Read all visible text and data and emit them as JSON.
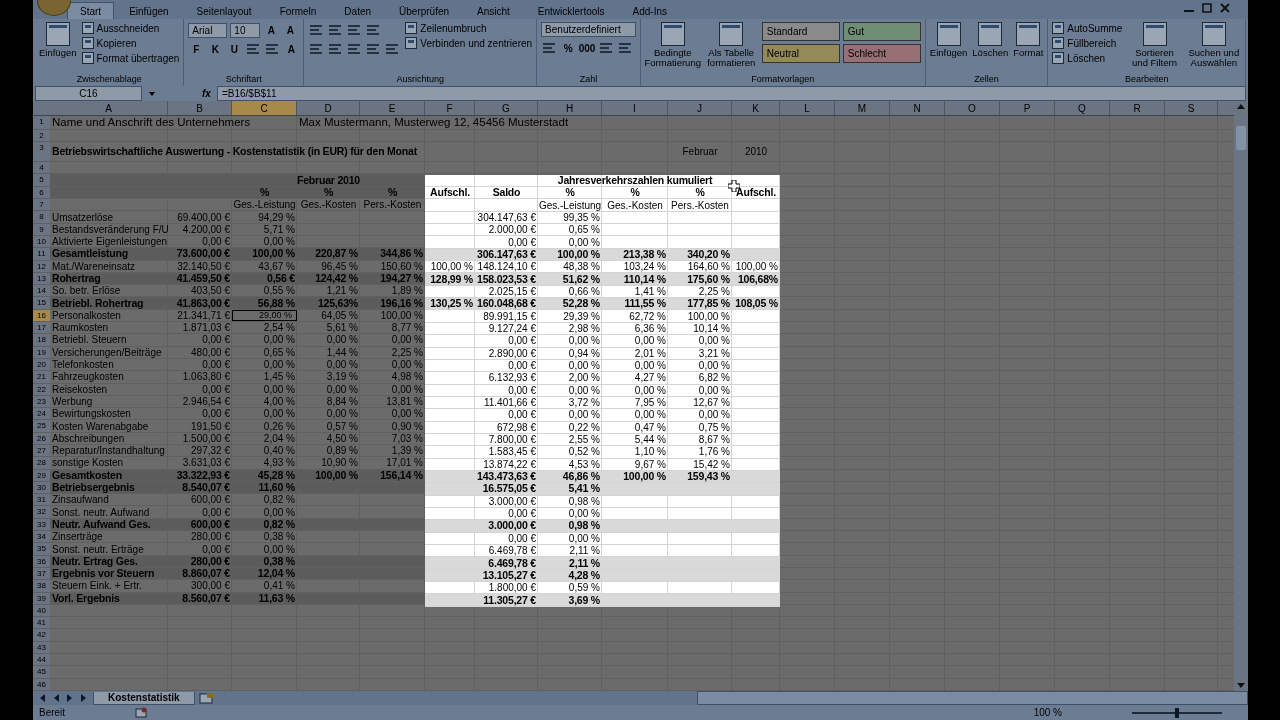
{
  "ribbon": {
    "tabs": [
      {
        "label": "Start",
        "selected": true
      },
      {
        "label": "Einfügen",
        "selected": false
      },
      {
        "label": "Seitenlayout",
        "selected": false
      },
      {
        "label": "Formeln",
        "selected": false
      },
      {
        "label": "Daten",
        "selected": false
      },
      {
        "label": "Überprüfen",
        "selected": false
      },
      {
        "label": "Ansicht",
        "selected": false
      },
      {
        "label": "Entwicklertools",
        "selected": false
      },
      {
        "label": "Add-Ins",
        "selected": false
      }
    ],
    "groups": [
      {
        "label": "Zwischenablage",
        "stacks": [
          [
            [
              {
                "kind": "large",
                "label": "Einfügen"
              }
            ]
          ],
          [
            [
              {
                "kind": "small",
                "label": "Ausschneiden"
              }
            ],
            [
              {
                "kind": "small",
                "label": "Kopieren"
              }
            ],
            [
              {
                "kind": "small",
                "label": "Format übertragen"
              }
            ]
          ]
        ]
      },
      {
        "label": "Schriftart",
        "stacks": [
          [
            [
              {
                "kind": "dropdown",
                "value": "Arial"
              },
              {
                "kind": "dropdown",
                "value": "10"
              },
              {
                "kind": "glyph",
                "label": "A"
              },
              {
                "kind": "glyph",
                "label": "A"
              }
            ],
            [
              {
                "kind": "glyph",
                "label": "F"
              },
              {
                "kind": "glyph",
                "label": "K"
              },
              {
                "kind": "glyph",
                "label": "U"
              },
              {
                "kind": "icon"
              },
              {
                "kind": "icon"
              },
              {
                "kind": "glyph",
                "label": "A"
              }
            ]
          ]
        ]
      },
      {
        "label": "Ausrichtung",
        "stacks": [
          [
            [
              {
                "kind": "icon"
              },
              {
                "kind": "icon"
              },
              {
                "kind": "icon"
              },
              {
                "kind": "icon"
              }
            ],
            [
              {
                "kind": "icon"
              },
              {
                "kind": "icon"
              },
              {
                "kind": "icon"
              },
              {
                "kind": "icon"
              },
              {
                "kind": "icon"
              }
            ]
          ],
          [
            [
              {
                "kind": "small",
                "label": "Zeilenumbruch"
              }
            ],
            [
              {
                "kind": "small",
                "label": "Verbinden und zentrieren"
              }
            ]
          ]
        ]
      },
      {
        "label": "Zahl",
        "stacks": [
          [
            [
              {
                "kind": "dropdown",
                "value": "Benutzerdefiniert"
              }
            ],
            [
              {
                "kind": "icon"
              },
              {
                "kind": "glyph",
                "label": "%"
              },
              {
                "kind": "glyph",
                "label": "000"
              },
              {
                "kind": "icon"
              },
              {
                "kind": "icon"
              }
            ]
          ]
        ]
      },
      {
        "label": "Formatvorlagen",
        "stacks": [
          [
            [
              {
                "kind": "large",
                "label": "Bedingte Formatierung"
              }
            ]
          ],
          [
            [
              {
                "kind": "large",
                "label": "Als Tabelle formatieren"
              }
            ]
          ],
          [
            [
              {
                "kind": "style",
                "label": "Standard",
                "color": "#8a8a8a"
              },
              {
                "kind": "style",
                "label": "Gut",
                "color": "#6f8f74"
              }
            ],
            [
              {
                "kind": "style",
                "label": "Neutral",
                "color": "#948a58"
              },
              {
                "kind": "style",
                "label": "Schlecht",
                "color": "#977076"
              }
            ]
          ]
        ]
      },
      {
        "label": "Zellen",
        "stacks": [
          [
            [
              {
                "kind": "large",
                "label": "Einfügen"
              }
            ]
          ],
          [
            [
              {
                "kind": "large",
                "label": "Löschen"
              }
            ]
          ],
          [
            [
              {
                "kind": "large",
                "label": "Format"
              }
            ]
          ]
        ]
      },
      {
        "label": "Bearbeiten",
        "stacks": [
          [
            [
              {
                "kind": "small",
                "label": "AutoSumme"
              }
            ],
            [
              {
                "kind": "small",
                "label": "Füllbereich"
              }
            ],
            [
              {
                "kind": "small",
                "label": "Löschen"
              }
            ]
          ],
          [
            [
              {
                "kind": "large",
                "label": "Sortieren und Filtern"
              }
            ]
          ],
          [
            [
              {
                "kind": "large",
                "label": "Suchen und Auswählen"
              }
            ]
          ]
        ]
      }
    ]
  },
  "formula_bar": {
    "name_box": "C16",
    "function_label": "fx",
    "formula": "=B16/$B$11"
  },
  "sheet": {
    "columns": [
      {
        "label": "A",
        "selected": false
      },
      {
        "label": "B",
        "selected": false
      },
      {
        "label": "C",
        "selected": true
      },
      {
        "label": "D",
        "selected": false
      },
      {
        "label": "E",
        "selected": false
      },
      {
        "label": "F",
        "selected": false
      },
      {
        "label": "G",
        "selected": false
      },
      {
        "label": "H",
        "selected": false
      },
      {
        "label": "I",
        "selected": false
      },
      {
        "label": "J",
        "selected": false
      },
      {
        "label": "K",
        "selected": false
      },
      {
        "label": "L",
        "selected": false
      },
      {
        "label": "M",
        "selected": false
      },
      {
        "label": "N",
        "selected": false
      },
      {
        "label": "O",
        "selected": false
      },
      {
        "label": "P",
        "selected": false
      },
      {
        "label": "Q",
        "selected": false
      },
      {
        "label": "R",
        "selected": false
      },
      {
        "label": "S",
        "selected": false
      }
    ],
    "rows": [
      {
        "number": "1",
        "selected": false,
        "kind": "note",
        "bold": false,
        "shaded": false,
        "cells": {
          "A": "Name und Anschrift des Unternehmers",
          "D": "Max Mustermann, Musterweg 12, 45456 Musterstadt"
        }
      },
      {
        "number": "2",
        "selected": false,
        "kind": "plain",
        "shaded": false,
        "cells": {}
      },
      {
        "number": "3",
        "selected": false,
        "kind": "title",
        "bold": true,
        "shaded": false,
        "cells": {
          "A": "Betriebswirtschaftliche Auswertung - Kostenstatistik (in EUR) für den Monat",
          "J": "Februar",
          "K": "2010"
        }
      },
      {
        "number": "4",
        "selected": false,
        "kind": "plain",
        "shaded": false,
        "cells": {}
      },
      {
        "number": "5",
        "selected": false,
        "kind": "header",
        "bold": true,
        "shaded": true,
        "cells": {
          "D": "Februar 2010"
        },
        "spotlight": {
          "bold": true,
          "shaded": false,
          "cells": {
            "I": "Jahresverkehrszahlen kumuliert"
          }
        }
      },
      {
        "number": "6",
        "selected": false,
        "kind": "header",
        "bold": true,
        "shaded": true,
        "cells": {
          "C": "%",
          "D": "%",
          "E": "%"
        },
        "spotlight": {
          "bold": true,
          "shaded": false,
          "cells": {
            "F": "Aufschl.",
            "G": "Saldo",
            "H": "%",
            "I": "%",
            "J": "%",
            "K": "Aufschl."
          }
        }
      },
      {
        "number": "7",
        "selected": false,
        "kind": "header",
        "bold": false,
        "shaded": false,
        "cells": {
          "C": "Ges.-Leistung",
          "D": "Ges.-Kosten",
          "E": "Pers.-Kosten"
        },
        "spotlight": {
          "bold": false,
          "shaded": false,
          "cells": {
            "H": "Ges.-Leistung",
            "I": "Ges.-Kosten",
            "J": "Pers.-Kosten"
          }
        }
      },
      {
        "number": "8",
        "selected": false,
        "kind": "plain",
        "bold": false,
        "shaded": false,
        "cells": {
          "A": "Umsatzerlöse",
          "B": "69.400,00 €",
          "C": "94,29 %"
        },
        "spotlight": {
          "bold": false,
          "shaded": false,
          "cells": {
            "G": "304.147,63 €",
            "H": "99,35 %"
          }
        }
      },
      {
        "number": "9",
        "selected": false,
        "kind": "plain",
        "bold": false,
        "shaded": false,
        "cells": {
          "A": "Bestandsveränderung F/U",
          "B": "4.200,00 €",
          "C": "5,71 %"
        },
        "spotlight": {
          "bold": false,
          "shaded": false,
          "cells": {
            "G": "2.000,00 €",
            "H": "0,65 %"
          }
        }
      },
      {
        "number": "10",
        "selected": false,
        "kind": "plain",
        "bold": false,
        "shaded": false,
        "cells": {
          "A": "Aktivierte Eigenleistungen",
          "B": "0,00 €",
          "C": "0,00 %"
        },
        "spotlight": {
          "bold": false,
          "shaded": false,
          "cells": {
            "G": "0,00 €",
            "H": "0,00 %"
          }
        }
      },
      {
        "number": "11",
        "selected": false,
        "kind": "plain",
        "bold": true,
        "shaded": true,
        "cells": {
          "A": "Gesamtleistung",
          "B": "73.600,00 €",
          "C": "100,00 %",
          "D": "220,87 %",
          "E": "344,86 %"
        },
        "spotlight": {
          "bold": true,
          "shaded": true,
          "cells": {
            "G": "306.147,63 €",
            "H": "100,00 %",
            "I": "213,38 %",
            "J": "340,20 %"
          }
        }
      },
      {
        "number": "12",
        "selected": false,
        "kind": "plain",
        "bold": false,
        "shaded": false,
        "cells": {
          "A": "Mat./Wareneinsatz",
          "B": "32.140,50 €",
          "C": "43,67 %",
          "D": "96,45 %",
          "E": "150,60 %"
        },
        "spotlight": {
          "bold": false,
          "shaded": false,
          "cells": {
            "F": "100,00 %",
            "G": "148.124,10 €",
            "H": "48,38 %",
            "I": "103,24 %",
            "J": "164,60 %",
            "K": "100,00 %"
          }
        }
      },
      {
        "number": "13",
        "selected": false,
        "kind": "plain",
        "bold": true,
        "shaded": true,
        "cells": {
          "A": "Rohertrag",
          "B": "41.459,50 €",
          "C": "0,56 €",
          "D": "124,42 %",
          "E": "194,27 %"
        },
        "spotlight": {
          "bold": true,
          "shaded": true,
          "cells": {
            "F": "128,99 %",
            "G": "158.023,53 €",
            "H": "51,62 %",
            "I": "110,14 %",
            "J": "175,60 %",
            "K": "106,68%"
          }
        }
      },
      {
        "number": "14",
        "selected": false,
        "kind": "plain",
        "bold": false,
        "shaded": false,
        "cells": {
          "A": "So. betr. Erlöse",
          "B": "403,50 €",
          "C": "0,55 %",
          "D": "1,21 %",
          "E": "1,89 %"
        },
        "spotlight": {
          "bold": false,
          "shaded": false,
          "cells": {
            "G": "2.025,15 €",
            "H": "0,66 %",
            "I": "1,41 %",
            "J": "2,25 %"
          }
        }
      },
      {
        "number": "15",
        "selected": false,
        "kind": "plain",
        "bold": true,
        "shaded": true,
        "cells": {
          "A": "Betriebl. Rohertrag",
          "B": "41.863,00 €",
          "C": "56,88 %",
          "D": "125,63%",
          "E": "196,16 %"
        },
        "spotlight": {
          "bold": true,
          "shaded": true,
          "cells": {
            "F": "130,25 %",
            "G": "160.048,68 €",
            "H": "52,28 %",
            "I": "111,55 %",
            "J": "177,85 %",
            "K": "108,05 %"
          }
        }
      },
      {
        "number": "16",
        "selected": true,
        "kind": "plain",
        "bold": false,
        "shaded": false,
        "cells": {
          "A": "Personalkosten",
          "B": "21.341,71 €",
          "C": "29,00 %",
          "D": "64,05 %",
          "E": "100,00 %"
        },
        "spotlight": {
          "bold": false,
          "shaded": false,
          "cells": {
            "G": "89.991,15 €",
            "H": "29,39 %",
            "I": "62,72 %",
            "J": "100,00 %"
          }
        }
      },
      {
        "number": "17",
        "selected": false,
        "kind": "plain",
        "bold": false,
        "shaded": false,
        "cells": {
          "A": "Raumkosten",
          "B": "1.871,03 €",
          "C": "2,54 %",
          "D": "5,61 %",
          "E": "8,77 %"
        },
        "spotlight": {
          "bold": false,
          "shaded": false,
          "cells": {
            "G": "9.127,24 €",
            "H": "2,98 %",
            "I": "6,36 %",
            "J": "10,14 %"
          }
        }
      },
      {
        "number": "18",
        "selected": false,
        "kind": "plain",
        "bold": false,
        "shaded": false,
        "cells": {
          "A": "Betriebl. Steuern",
          "B": "0,00 €",
          "C": "0,00 %",
          "D": "0,00 %",
          "E": "0,00 %"
        },
        "spotlight": {
          "bold": false,
          "shaded": false,
          "cells": {
            "G": "0,00 €",
            "H": "0,00 %",
            "I": "0,00 %",
            "J": "0,00 %"
          }
        }
      },
      {
        "number": "19",
        "selected": false,
        "kind": "plain",
        "bold": false,
        "shaded": false,
        "cells": {
          "A": "Versicherungen/Beiträge",
          "B": "480,00 €",
          "C": "0,65 %",
          "D": "1,44 %",
          "E": "2,25 %"
        },
        "spotlight": {
          "bold": false,
          "shaded": false,
          "cells": {
            "G": "2.890,00 €",
            "H": "0,94 %",
            "I": "2,01 %",
            "J": "3,21 %"
          }
        }
      },
      {
        "number": "20",
        "selected": false,
        "kind": "plain",
        "bold": false,
        "shaded": false,
        "cells": {
          "A": "Telefonkosten",
          "B": "0,00 €",
          "C": "0,00 %",
          "D": "0,00 %",
          "E": "0,00 %"
        },
        "spotlight": {
          "bold": false,
          "shaded": false,
          "cells": {
            "G": "0,00 €",
            "H": "0,00 %",
            "I": "0,00 %",
            "J": "0,00 %"
          }
        }
      },
      {
        "number": "21",
        "selected": false,
        "kind": "plain",
        "bold": false,
        "shaded": false,
        "cells": {
          "A": "Fahrzeugkosten",
          "B": "1.063,80 €",
          "C": "1,45 %",
          "D": "3,19 %",
          "E": "4,98 %"
        },
        "spotlight": {
          "bold": false,
          "shaded": false,
          "cells": {
            "G": "6.132,93 €",
            "H": "2,00 %",
            "I": "4,27 %",
            "J": "6,82 %"
          }
        }
      },
      {
        "number": "22",
        "selected": false,
        "kind": "plain",
        "bold": false,
        "shaded": false,
        "cells": {
          "A": "Reisekosten",
          "B": "0,00 €",
          "C": "0,00 %",
          "D": "0,00 %",
          "E": "0,00 %"
        },
        "spotlight": {
          "bold": false,
          "shaded": false,
          "cells": {
            "G": "0,00 €",
            "H": "0,00 %",
            "I": "0,00 %",
            "J": "0,00 %"
          }
        }
      },
      {
        "number": "23",
        "selected": false,
        "kind": "plain",
        "bold": false,
        "shaded": false,
        "cells": {
          "A": "Werbung",
          "B": "2.946,54 €",
          "C": "4,00 %",
          "D": "8,84 %",
          "E": "13,81 %"
        },
        "spotlight": {
          "bold": false,
          "shaded": false,
          "cells": {
            "G": "11.401,66 €",
            "H": "3,72 %",
            "I": "7,95 %",
            "J": "12,67 %"
          }
        }
      },
      {
        "number": "24",
        "selected": false,
        "kind": "plain",
        "bold": false,
        "shaded": false,
        "cells": {
          "A": "Bewirtungskosten",
          "B": "0,00 €",
          "C": "0,00 %",
          "D": "0,00 %",
          "E": "0,00 %"
        },
        "spotlight": {
          "bold": false,
          "shaded": false,
          "cells": {
            "G": "0,00 €",
            "H": "0,00 %",
            "I": "0,00 %",
            "J": "0,00 %"
          }
        }
      },
      {
        "number": "25",
        "selected": false,
        "kind": "plain",
        "bold": false,
        "shaded": false,
        "cells": {
          "A": "Kosten Warenabgabe",
          "B": "191,50 €",
          "C": "0,26 %",
          "D": "0,57 %",
          "E": "0,90 %"
        },
        "spotlight": {
          "bold": false,
          "shaded": false,
          "cells": {
            "G": "672,98 €",
            "H": "0,22 %",
            "I": "0,47 %",
            "J": "0,75 %"
          }
        }
      },
      {
        "number": "26",
        "selected": false,
        "kind": "plain",
        "bold": false,
        "shaded": false,
        "cells": {
          "A": "Abschreibungen",
          "B": "1.500,00 €",
          "C": "2,04 %",
          "D": "4,50 %",
          "E": "7,03 %"
        },
        "spotlight": {
          "bold": false,
          "shaded": false,
          "cells": {
            "G": "7.800,00 €",
            "H": "2,55 %",
            "I": "5,44 %",
            "J": "8,67 %"
          }
        }
      },
      {
        "number": "27",
        "selected": false,
        "kind": "plain",
        "bold": false,
        "shaded": false,
        "cells": {
          "A": "Reparatur/Instandhaltung",
          "B": "297,32 €",
          "C": "0,40 %",
          "D": "0,89 %",
          "E": "1,39 %"
        },
        "spotlight": {
          "bold": false,
          "shaded": false,
          "cells": {
            "G": "1.583,45 €",
            "H": "0,52 %",
            "I": "1,10 %",
            "J": "1,76 %"
          }
        }
      },
      {
        "number": "28",
        "selected": false,
        "kind": "plain",
        "bold": false,
        "shaded": false,
        "cells": {
          "A": "sonstige Kosten",
          "B": "3.631,03 €",
          "C": "4,93 %",
          "D": "10,90 %",
          "E": "17,01 %"
        },
        "spotlight": {
          "bold": false,
          "shaded": false,
          "cells": {
            "G": "13.874,22 €",
            "H": "4,53 %",
            "I": "9,67 %",
            "J": "15,42 %"
          }
        }
      },
      {
        "number": "29",
        "selected": false,
        "kind": "plain",
        "bold": true,
        "shaded": true,
        "cells": {
          "A": "Gesamtkosten",
          "B": "33.322,93 €",
          "C": "45,28 %",
          "D": "100,00 %",
          "E": "156,14 %"
        },
        "spotlight": {
          "bold": true,
          "shaded": true,
          "cells": {
            "G": "143.473,63 €",
            "H": "46,86 %",
            "I": "100,00 %",
            "J": "159,43 %"
          }
        }
      },
      {
        "number": "30",
        "selected": false,
        "kind": "plain",
        "bold": true,
        "shaded": true,
        "cells": {
          "A": "Betriebsergebnis",
          "B": "8.540,07 €",
          "C": "11,60 %"
        },
        "spotlight": {
          "bold": true,
          "shaded": true,
          "cells": {
            "G": "16.575,05 €",
            "H": "5,41 %"
          }
        }
      },
      {
        "number": "31",
        "selected": false,
        "kind": "plain",
        "bold": false,
        "shaded": false,
        "cells": {
          "A": "Zinsaufwand",
          "B": "600,00 €",
          "C": "0,82 %"
        },
        "spotlight": {
          "bold": false,
          "shaded": false,
          "cells": {
            "G": "3.000,00 €",
            "H": "0,98 %"
          }
        }
      },
      {
        "number": "32",
        "selected": false,
        "kind": "plain",
        "bold": false,
        "shaded": false,
        "cells": {
          "A": "Sonst. neutr. Aufwand",
          "B": "0,00 €",
          "C": "0,00 %"
        },
        "spotlight": {
          "bold": false,
          "shaded": false,
          "cells": {
            "G": "0,00 €",
            "H": "0,00 %"
          }
        }
      },
      {
        "number": "33",
        "selected": false,
        "kind": "plain",
        "bold": true,
        "shaded": true,
        "cells": {
          "A": "Neutr. Aufwand Ges.",
          "B": "600,00 €",
          "C": "0,82 %"
        },
        "spotlight": {
          "bold": true,
          "shaded": true,
          "cells": {
            "G": "3.000,00 €",
            "H": "0,98 %"
          }
        }
      },
      {
        "number": "34",
        "selected": false,
        "kind": "plain",
        "bold": false,
        "shaded": false,
        "cells": {
          "A": "Zinserträge",
          "B": "280,00 €",
          "C": "0,38 %"
        },
        "spotlight": {
          "bold": false,
          "shaded": false,
          "cells": {
            "G": "0,00 €",
            "H": "0,00 %"
          }
        }
      },
      {
        "number": "35",
        "selected": false,
        "kind": "plain",
        "bold": false,
        "shaded": false,
        "cells": {
          "A": "Sonst. neutr. Erträge",
          "B": "0,00 €",
          "C": "0,00 %"
        },
        "spotlight": {
          "bold": false,
          "shaded": false,
          "cells": {
            "G": "6.469,78 €",
            "H": "2,11 %"
          }
        }
      },
      {
        "number": "36",
        "selected": false,
        "kind": "plain",
        "bold": true,
        "shaded": true,
        "cells": {
          "A": "Neutr. Ertrag Ges.",
          "B": "280,00 €",
          "C": "0,38 %"
        },
        "spotlight": {
          "bold": true,
          "shaded": true,
          "cells": {
            "G": "6.469,78 €",
            "H": "2,11 %"
          }
        }
      },
      {
        "number": "37",
        "selected": false,
        "kind": "plain",
        "bold": true,
        "shaded": true,
        "cells": {
          "A": "Ergebnis vor Steuern",
          "B": "8.860,07 €",
          "C": "12,04 %"
        },
        "spotlight": {
          "bold": true,
          "shaded": true,
          "cells": {
            "G": "13.105,27 €",
            "H": "4,28 %"
          }
        }
      },
      {
        "number": "38",
        "selected": false,
        "kind": "plain",
        "bold": false,
        "shaded": false,
        "cells": {
          "A": "Steuern Eink. + Ertr.",
          "B": "300,00 €",
          "C": "0,41 %"
        },
        "spotlight": {
          "bold": false,
          "shaded": false,
          "cells": {
            "G": "1.800,00 €",
            "H": "0,59 %"
          }
        }
      },
      {
        "number": "39",
        "selected": false,
        "kind": "plain",
        "bold": true,
        "shaded": true,
        "cells": {
          "A": "Vorl. Ergebnis",
          "B": "8.560,07 €",
          "C": "11,63 %"
        },
        "spotlight": {
          "bold": true,
          "shaded": true,
          "cells": {
            "G": "11.305,27 €",
            "H": "3,69 %"
          }
        }
      },
      {
        "number": "40",
        "selected": false,
        "kind": "plain",
        "shaded": false,
        "cells": {}
      },
      {
        "number": "41",
        "selected": false,
        "kind": "plain",
        "shaded": false,
        "cells": {}
      },
      {
        "number": "42",
        "selected": false,
        "kind": "plain",
        "shaded": false,
        "cells": {}
      },
      {
        "number": "43",
        "selected": false,
        "kind": "plain",
        "shaded": false,
        "cells": {}
      },
      {
        "number": "44",
        "selected": false,
        "kind": "plain",
        "shaded": false,
        "cells": {}
      },
      {
        "number": "45",
        "selected": false,
        "kind": "plain",
        "shaded": false,
        "cells": {}
      },
      {
        "number": "46",
        "selected": false,
        "kind": "plain",
        "shaded": false,
        "cells": {}
      }
    ]
  },
  "sheet_tabs": [
    {
      "label": "Kostenstatistik",
      "selected": true
    }
  ],
  "status_bar": {
    "status": "Bereit",
    "zoom": "100 %",
    "zoom_slider": {
      "level": 0.5
    }
  }
}
